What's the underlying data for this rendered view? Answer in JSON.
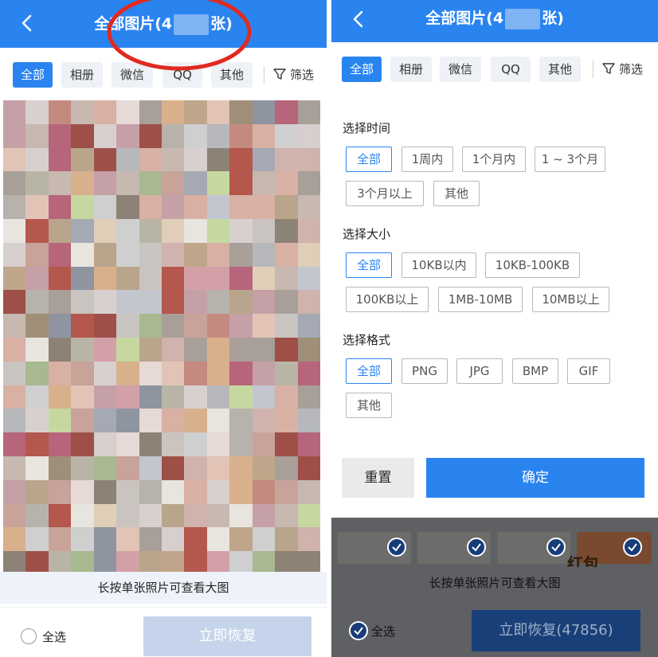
{
  "left": {
    "header": {
      "title_prefix": "全部图片(4",
      "title_suffix": "张)"
    },
    "tabs": [
      "全部",
      "相册",
      "微信",
      "QQ",
      "其他"
    ],
    "filter_label": "筛选",
    "hint": "长按单张照片可查看大图",
    "select_all": "全选",
    "restore_label": "立即恢复",
    "colors": {
      "primary": "#2a84f0",
      "restore_disabled": "#c5d4ea",
      "annotation": "#e02a1f"
    }
  },
  "right": {
    "header": {
      "title_prefix": "全部图片(4",
      "title_suffix": "张)"
    },
    "tabs": [
      "全部",
      "相册",
      "微信",
      "QQ",
      "其他"
    ],
    "filter_label": "筛选",
    "sheet": {
      "time": {
        "title": "选择时间",
        "options": [
          "全部",
          "1周内",
          "1个月内",
          "1 ~ 3个月",
          "3个月以上",
          "其他"
        ],
        "selected": "全部"
      },
      "size": {
        "title": "选择大小",
        "options": [
          "全部",
          "10KB以内",
          "10KB-100KB",
          "100KB以上",
          "1MB-10MB",
          "10MB以上"
        ],
        "selected": "全部"
      },
      "format": {
        "title": "选择格式",
        "options": [
          "全部",
          "PNG",
          "JPG",
          "BMP",
          "GIF",
          "其他"
        ],
        "selected": "全部"
      },
      "reset_label": "重置",
      "confirm_label": "确定"
    },
    "hint": "长按单张照片可查看大图",
    "background_text": "红包",
    "select_all": "全选",
    "restore_label": "立即恢复(47856)",
    "colors": {
      "restore_dimmed": "#183f78"
    }
  }
}
